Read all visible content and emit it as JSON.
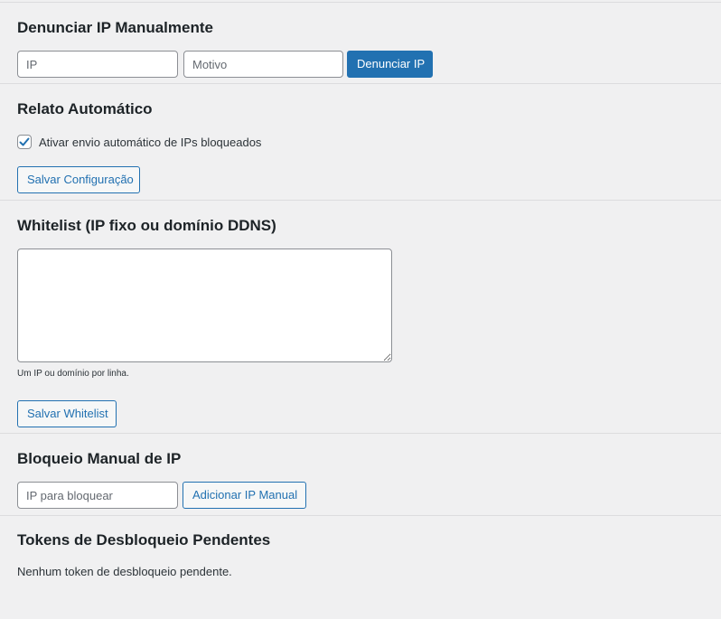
{
  "manual_report": {
    "heading": "Denunciar IP Manualmente",
    "ip_placeholder": "IP",
    "reason_placeholder": "Motivo",
    "submit_label": "Denunciar IP"
  },
  "auto_report": {
    "heading": "Relato Automático",
    "checkbox_label": "Ativar envio automático de IPs bloqueados",
    "checkbox_checked": true,
    "save_label": "Salvar Configuração"
  },
  "whitelist": {
    "heading": "Whitelist (IP fixo ou domínio DDNS)",
    "textarea_value": "",
    "description": "Um IP ou domínio por linha.",
    "save_label": "Salvar Whitelist"
  },
  "manual_block": {
    "heading": "Bloqueio Manual de IP",
    "ip_placeholder": "IP para bloquear",
    "add_label": "Adicionar IP Manual"
  },
  "pending_tokens": {
    "heading": "Tokens de Desbloqueio Pendentes",
    "empty_message": "Nenhum token de desbloqueio pendente."
  },
  "colors": {
    "accent": "#2271b1",
    "background": "#f0f0f1",
    "text": "#1d2327",
    "divider": "#dcdcde"
  }
}
